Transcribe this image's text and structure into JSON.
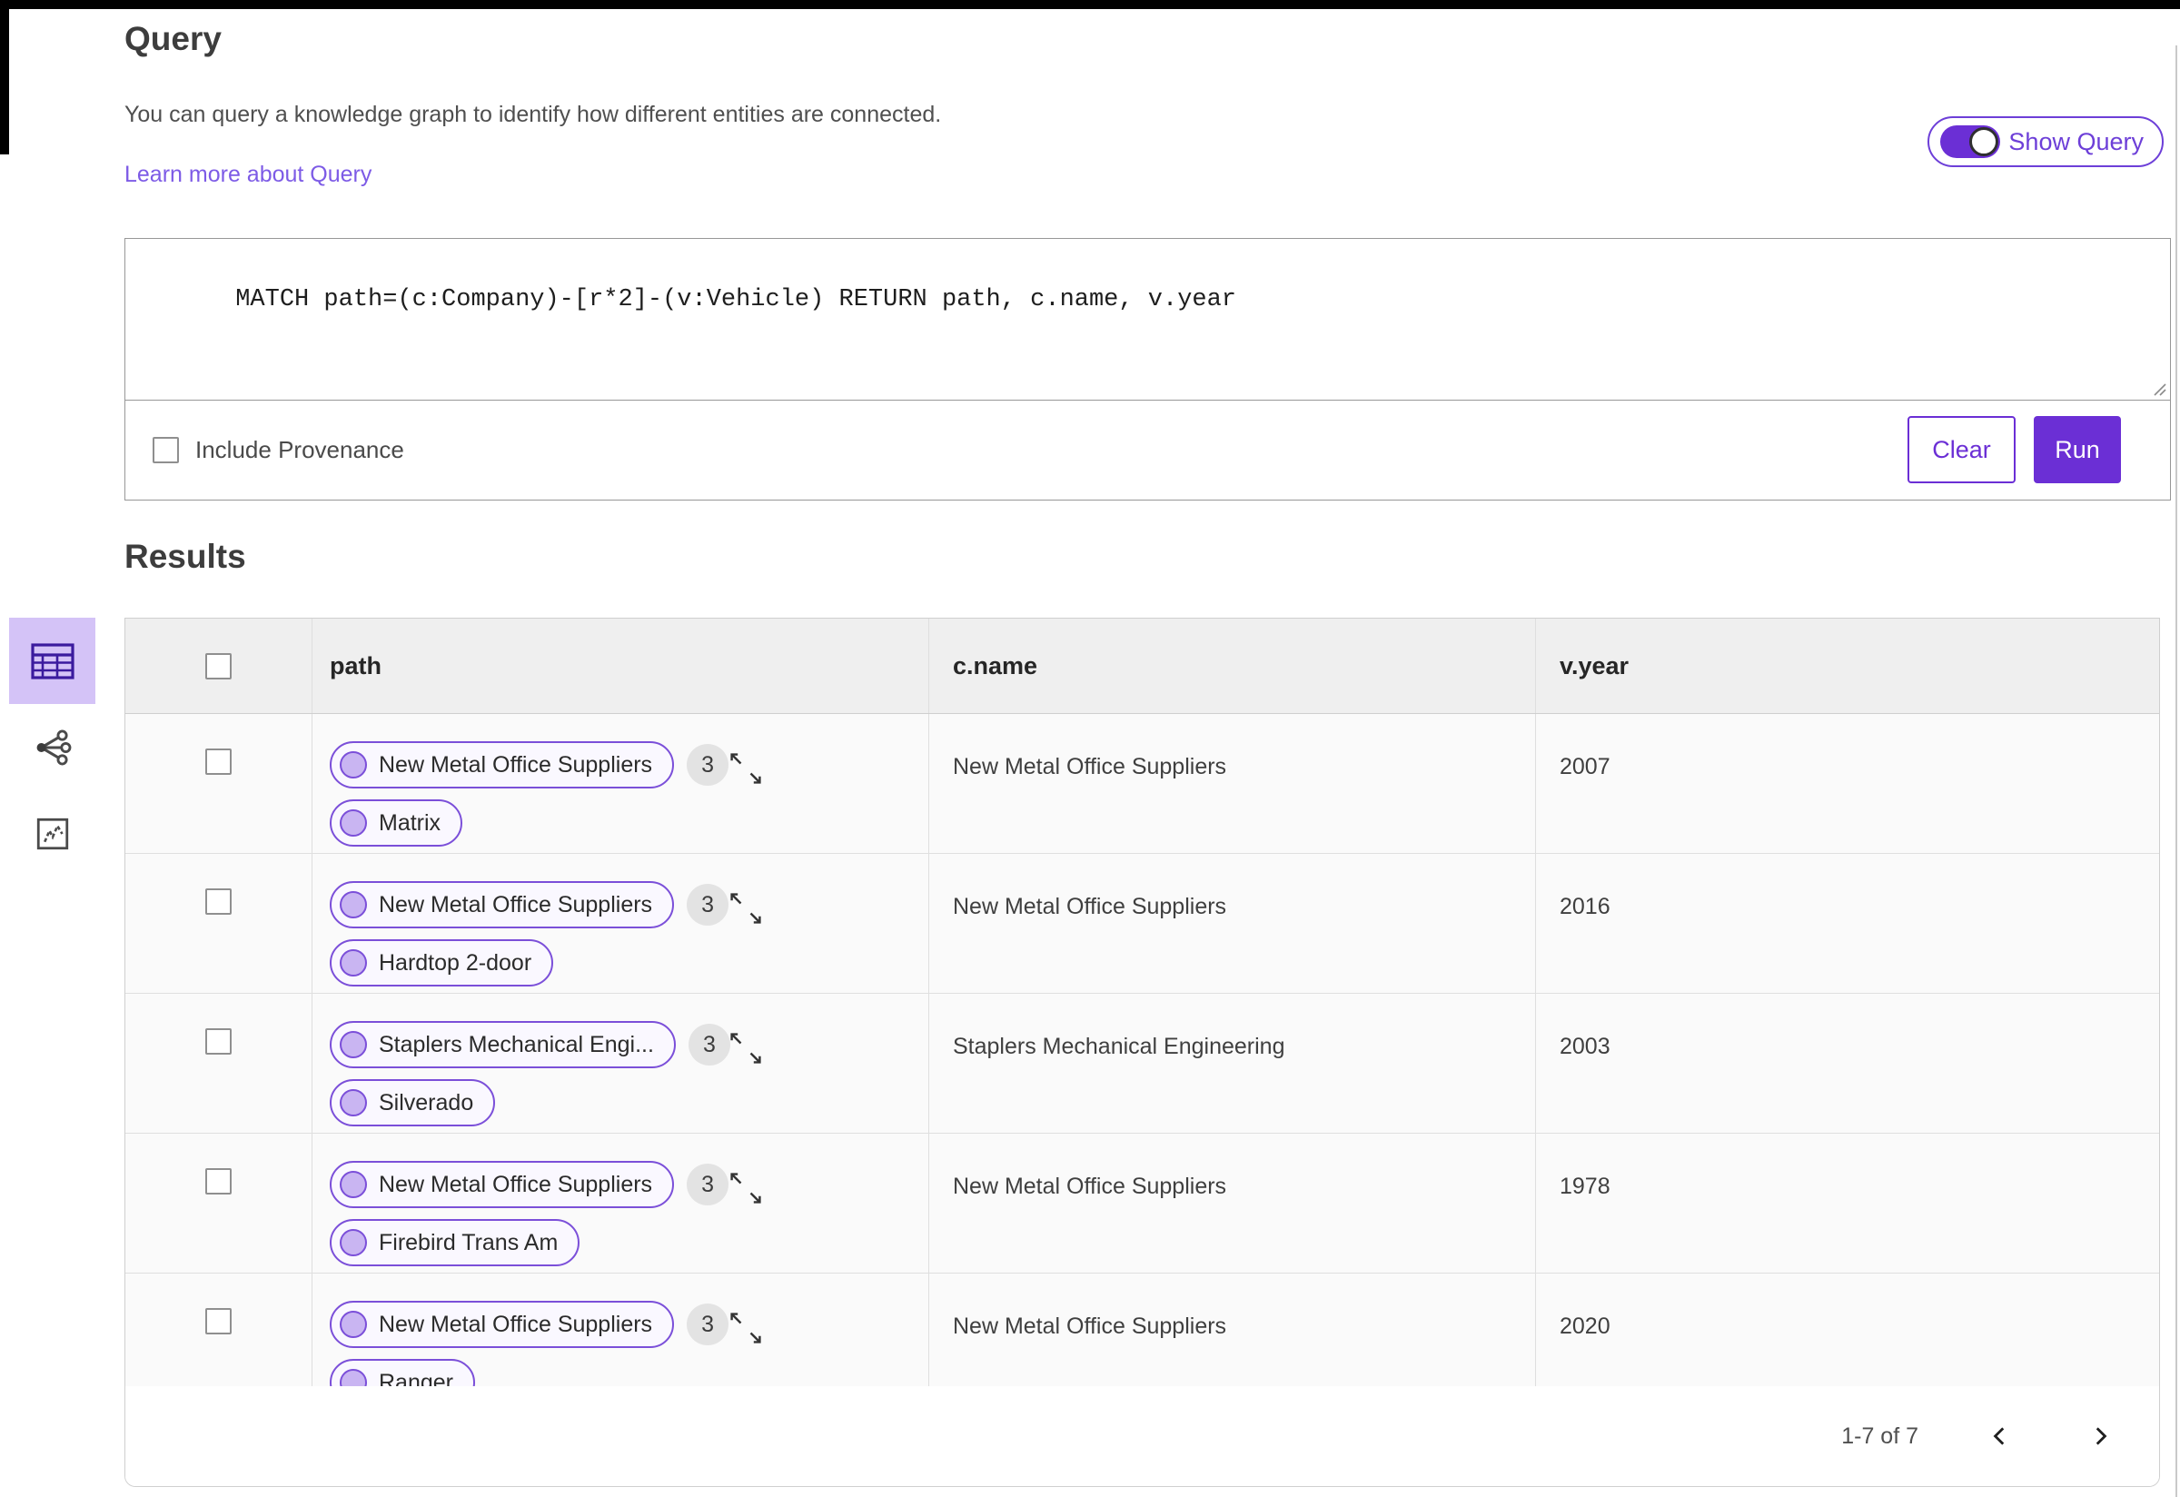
{
  "query_section": {
    "title": "Query",
    "description": "You can query a knowledge graph to identify how different entities are connected.",
    "learn_more_link": "Learn more about Query",
    "show_query_toggle": {
      "label": "Show Query",
      "state": "on"
    },
    "editor": {
      "query_text": "MATCH path=(c:Company)-[r*2]-(v:Vehicle) RETURN path, c.name, v.year"
    },
    "include_provenance": {
      "label": "Include Provenance",
      "checked": false
    },
    "buttons": {
      "clear": "Clear",
      "run": "Run"
    }
  },
  "results_section": {
    "title": "Results",
    "view_rail": {
      "icons": [
        {
          "name": "table-view-icon",
          "selected": true
        },
        {
          "name": "graph-view-icon",
          "selected": false
        },
        {
          "name": "scatter-view-icon",
          "selected": false
        }
      ]
    },
    "table": {
      "columns": [
        "path",
        "c.name",
        "v.year"
      ],
      "rows": [
        {
          "path_nodes": [
            "New Metal Office Suppliers",
            "Matrix"
          ],
          "count": "3",
          "c_name": "New Metal Office Suppliers",
          "v_year": "2007"
        },
        {
          "path_nodes": [
            "New Metal Office Suppliers",
            "Hardtop 2-door"
          ],
          "count": "3",
          "c_name": "New Metal Office Suppliers",
          "v_year": "2016"
        },
        {
          "path_nodes": [
            "Staplers Mechanical Engi...",
            "Silverado"
          ],
          "count": "3",
          "c_name": "Staplers Mechanical Engineering",
          "v_year": "2003"
        },
        {
          "path_nodes": [
            "New Metal Office Suppliers",
            "Firebird Trans Am"
          ],
          "count": "3",
          "c_name": "New Metal Office Suppliers",
          "v_year": "1978"
        },
        {
          "path_nodes": [
            "New Metal Office Suppliers",
            "Ranger"
          ],
          "count": "3",
          "c_name": "New Metal Office Suppliers",
          "v_year": "2020"
        }
      ],
      "pagination": {
        "range_text": "1-7 of 7"
      }
    }
  },
  "colors": {
    "accent_purple": "#6b2fd5",
    "toggle_border_purple": "#6d3fd8",
    "link_purple": "#7d5be6",
    "pill_border": "#7b4fd9",
    "pill_fill": "#faf8ff",
    "node_dot_fill": "#c9b5f2",
    "selected_rail_bg": "#d4c3f7",
    "rail_icon_purple": "#3b1b9e",
    "table_header_bg": "#efefef",
    "row_bg": "#fafafa",
    "border_gray": "#cfcfcf",
    "badge_gray": "#e3e3e3"
  }
}
